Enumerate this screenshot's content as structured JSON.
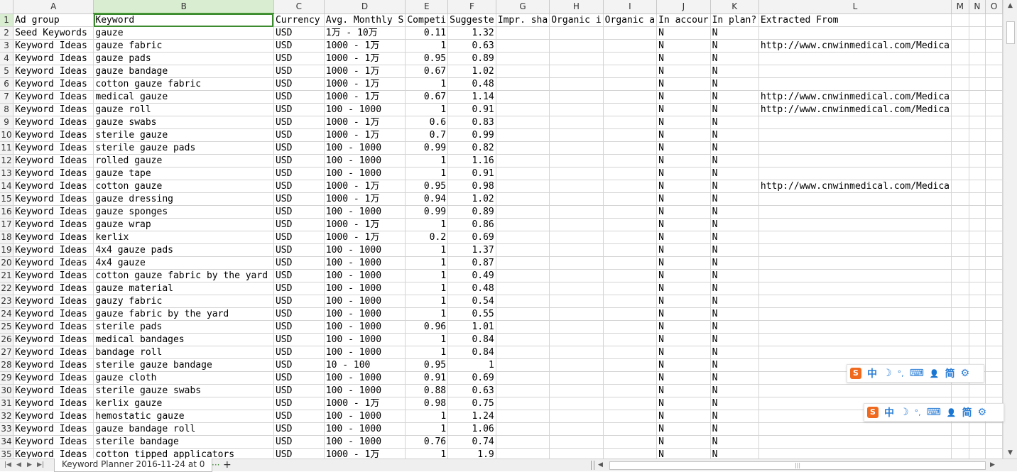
{
  "columns": [
    "A",
    "B",
    "C",
    "D",
    "E",
    "F",
    "G",
    "H",
    "I",
    "J",
    "K",
    "L",
    "M",
    "N",
    "O"
  ],
  "rows": [
    {
      "n": "1",
      "c": [
        "Ad group",
        "Keyword",
        "Currency",
        "Avg. Monthly S",
        "Competi",
        "Suggeste",
        "Impr. sha",
        "Organic i",
        "Organic a",
        "In accour",
        "In plan?",
        "Extracted From",
        "",
        "",
        ""
      ]
    },
    {
      "n": "2",
      "c": [
        "Seed Keywords",
        "gauze",
        "USD",
        "1万 - 10万",
        "0.11",
        "1.32",
        "",
        "",
        "",
        "N",
        "N",
        "",
        "",
        "",
        ""
      ]
    },
    {
      "n": "3",
      "c": [
        "Keyword Ideas",
        "gauze fabric",
        "USD",
        "1000 - 1万",
        "1",
        "0.63",
        "",
        "",
        "",
        "N",
        "N",
        "http://www.cnwinmedical.com/Medica",
        "",
        "",
        ""
      ]
    },
    {
      "n": "4",
      "c": [
        "Keyword Ideas",
        "gauze pads",
        "USD",
        "1000 - 1万",
        "0.95",
        "0.89",
        "",
        "",
        "",
        "N",
        "N",
        "",
        "",
        "",
        ""
      ]
    },
    {
      "n": "5",
      "c": [
        "Keyword Ideas",
        "gauze bandage",
        "USD",
        "1000 - 1万",
        "0.67",
        "1.02",
        "",
        "",
        "",
        "N",
        "N",
        "",
        "",
        "",
        ""
      ]
    },
    {
      "n": "6",
      "c": [
        "Keyword Ideas",
        "cotton gauze fabric",
        "USD",
        "1000 - 1万",
        "1",
        "0.48",
        "",
        "",
        "",
        "N",
        "N",
        "",
        "",
        "",
        ""
      ]
    },
    {
      "n": "7",
      "c": [
        "Keyword Ideas",
        "medical gauze",
        "USD",
        "1000 - 1万",
        "0.67",
        "1.14",
        "",
        "",
        "",
        "N",
        "N",
        "http://www.cnwinmedical.com/Medica",
        "",
        "",
        ""
      ]
    },
    {
      "n": "8",
      "c": [
        "Keyword Ideas",
        "gauze roll",
        "USD",
        "100 - 1000",
        "1",
        "0.91",
        "",
        "",
        "",
        "N",
        "N",
        "http://www.cnwinmedical.com/Medica",
        "",
        "",
        ""
      ]
    },
    {
      "n": "9",
      "c": [
        "Keyword Ideas",
        "gauze swabs",
        "USD",
        "1000 - 1万",
        "0.6",
        "0.83",
        "",
        "",
        "",
        "N",
        "N",
        "",
        "",
        "",
        ""
      ]
    },
    {
      "n": "10",
      "c": [
        "Keyword Ideas",
        "sterile gauze",
        "USD",
        "1000 - 1万",
        "0.7",
        "0.99",
        "",
        "",
        "",
        "N",
        "N",
        "",
        "",
        "",
        ""
      ]
    },
    {
      "n": "11",
      "c": [
        "Keyword Ideas",
        "sterile gauze pads",
        "USD",
        "100 - 1000",
        "0.99",
        "0.82",
        "",
        "",
        "",
        "N",
        "N",
        "",
        "",
        "",
        ""
      ]
    },
    {
      "n": "12",
      "c": [
        "Keyword Ideas",
        "rolled gauze",
        "USD",
        "100 - 1000",
        "1",
        "1.16",
        "",
        "",
        "",
        "N",
        "N",
        "",
        "",
        "",
        ""
      ]
    },
    {
      "n": "13",
      "c": [
        "Keyword Ideas",
        "gauze tape",
        "USD",
        "100 - 1000",
        "1",
        "0.91",
        "",
        "",
        "",
        "N",
        "N",
        "",
        "",
        "",
        ""
      ]
    },
    {
      "n": "14",
      "c": [
        "Keyword Ideas",
        "cotton gauze",
        "USD",
        "1000 - 1万",
        "0.95",
        "0.98",
        "",
        "",
        "",
        "N",
        "N",
        "http://www.cnwinmedical.com/Medica",
        "",
        "",
        ""
      ]
    },
    {
      "n": "15",
      "c": [
        "Keyword Ideas",
        "gauze dressing",
        "USD",
        "1000 - 1万",
        "0.94",
        "1.02",
        "",
        "",
        "",
        "N",
        "N",
        "",
        "",
        "",
        ""
      ]
    },
    {
      "n": "16",
      "c": [
        "Keyword Ideas",
        "gauze sponges",
        "USD",
        "100 - 1000",
        "0.99",
        "0.89",
        "",
        "",
        "",
        "N",
        "N",
        "",
        "",
        "",
        ""
      ]
    },
    {
      "n": "17",
      "c": [
        "Keyword Ideas",
        "gauze wrap",
        "USD",
        "1000 - 1万",
        "1",
        "0.86",
        "",
        "",
        "",
        "N",
        "N",
        "",
        "",
        "",
        ""
      ]
    },
    {
      "n": "18",
      "c": [
        "Keyword Ideas",
        "kerlix",
        "USD",
        "1000 - 1万",
        "0.2",
        "0.69",
        "",
        "",
        "",
        "N",
        "N",
        "",
        "",
        "",
        ""
      ]
    },
    {
      "n": "19",
      "c": [
        "Keyword Ideas",
        "4x4 gauze pads",
        "USD",
        "100 - 1000",
        "1",
        "1.37",
        "",
        "",
        "",
        "N",
        "N",
        "",
        "",
        "",
        ""
      ]
    },
    {
      "n": "20",
      "c": [
        "Keyword Ideas",
        "4x4 gauze",
        "USD",
        "100 - 1000",
        "1",
        "0.87",
        "",
        "",
        "",
        "N",
        "N",
        "",
        "",
        "",
        ""
      ]
    },
    {
      "n": "21",
      "c": [
        "Keyword Ideas",
        "cotton gauze fabric by the yard",
        "USD",
        "100 - 1000",
        "1",
        "0.49",
        "",
        "",
        "",
        "N",
        "N",
        "",
        "",
        "",
        ""
      ]
    },
    {
      "n": "22",
      "c": [
        "Keyword Ideas",
        "gauze material",
        "USD",
        "100 - 1000",
        "1",
        "0.48",
        "",
        "",
        "",
        "N",
        "N",
        "",
        "",
        "",
        ""
      ]
    },
    {
      "n": "23",
      "c": [
        "Keyword Ideas",
        "gauzy fabric",
        "USD",
        "100 - 1000",
        "1",
        "0.54",
        "",
        "",
        "",
        "N",
        "N",
        "",
        "",
        "",
        ""
      ]
    },
    {
      "n": "24",
      "c": [
        "Keyword Ideas",
        "gauze fabric by the yard",
        "USD",
        "100 - 1000",
        "1",
        "0.55",
        "",
        "",
        "",
        "N",
        "N",
        "",
        "",
        "",
        ""
      ]
    },
    {
      "n": "25",
      "c": [
        "Keyword Ideas",
        "sterile pads",
        "USD",
        "100 - 1000",
        "0.96",
        "1.01",
        "",
        "",
        "",
        "N",
        "N",
        "",
        "",
        "",
        ""
      ]
    },
    {
      "n": "26",
      "c": [
        "Keyword Ideas",
        "medical bandages",
        "USD",
        "100 - 1000",
        "1",
        "0.84",
        "",
        "",
        "",
        "N",
        "N",
        "",
        "",
        "",
        ""
      ]
    },
    {
      "n": "27",
      "c": [
        "Keyword Ideas",
        "bandage roll",
        "USD",
        "100 - 1000",
        "1",
        "0.84",
        "",
        "",
        "",
        "N",
        "N",
        "",
        "",
        "",
        ""
      ]
    },
    {
      "n": "28",
      "c": [
        "Keyword Ideas",
        "sterile gauze bandage",
        "USD",
        "10 - 100",
        "0.95",
        "1",
        "",
        "",
        "",
        "N",
        "N",
        "",
        "",
        "",
        ""
      ]
    },
    {
      "n": "29",
      "c": [
        "Keyword Ideas",
        "gauze cloth",
        "USD",
        "100 - 1000",
        "0.91",
        "0.69",
        "",
        "",
        "",
        "N",
        "N",
        "",
        "",
        "",
        ""
      ]
    },
    {
      "n": "30",
      "c": [
        "Keyword Ideas",
        "sterile gauze swabs",
        "USD",
        "100 - 1000",
        "0.88",
        "0.63",
        "",
        "",
        "",
        "N",
        "N",
        "",
        "",
        "",
        ""
      ]
    },
    {
      "n": "31",
      "c": [
        "Keyword Ideas",
        "kerlix gauze",
        "USD",
        "1000 - 1万",
        "0.98",
        "0.75",
        "",
        "",
        "",
        "N",
        "N",
        "",
        "",
        "",
        ""
      ]
    },
    {
      "n": "32",
      "c": [
        "Keyword Ideas",
        "hemostatic gauze",
        "USD",
        "100 - 1000",
        "1",
        "1.24",
        "",
        "",
        "",
        "N",
        "N",
        "",
        "",
        "",
        ""
      ]
    },
    {
      "n": "33",
      "c": [
        "Keyword Ideas",
        "gauze bandage roll",
        "USD",
        "100 - 1000",
        "1",
        "1.06",
        "",
        "",
        "",
        "N",
        "N",
        "",
        "",
        "",
        ""
      ]
    },
    {
      "n": "34",
      "c": [
        "Keyword Ideas",
        "sterile bandage",
        "USD",
        "100 - 1000",
        "0.76",
        "0.74",
        "",
        "",
        "",
        "N",
        "N",
        "",
        "",
        "",
        ""
      ]
    },
    {
      "n": "35",
      "c": [
        "Keyword Ideas",
        "cotton tipped applicators",
        "USD",
        "1000 - 1万",
        "1",
        "1.9",
        "",
        "",
        "",
        "N",
        "N",
        "",
        "",
        "",
        ""
      ]
    }
  ],
  "sheet_tab": "Keyword Planner 2016-11-24 at 0",
  "more_tabs_glyph": "···",
  "add_sheet_glyph": "+",
  "ime_toolbar": {
    "logo": "S",
    "mode": "中",
    "moon": "☽",
    "punct": "°,",
    "keyboard": "⌨",
    "user": "👤",
    "simplified": "简",
    "settings": "⚙"
  }
}
